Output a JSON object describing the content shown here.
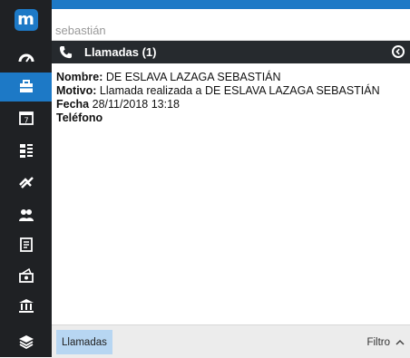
{
  "logo": {
    "letter": "m"
  },
  "search": {
    "value": "sebastián"
  },
  "header": {
    "title": "Llamadas (1)"
  },
  "record": {
    "nombre_label": "Nombre:",
    "nombre_value": " DE ESLAVA LAZAGA SEBASTIÁN",
    "motivo_label": "Motivo:",
    "motivo_value": " Llamada realizada a DE ESLAVA LAZAGA SEBASTIÁN",
    "fecha_label": "Fecha",
    "fecha_value": " 28/11/2018 13:18",
    "telefono_label": "Teléfono"
  },
  "bottom": {
    "tab_label": "Llamadas",
    "filter_label": "Filtro"
  },
  "sidebar": {
    "items": [
      {
        "icon": "dashboard-icon"
      },
      {
        "icon": "briefcase-icon",
        "active": true
      },
      {
        "icon": "calendar-icon",
        "text": "7"
      },
      {
        "icon": "list-icon"
      },
      {
        "icon": "handshake-icon"
      },
      {
        "icon": "contacts-icon"
      },
      {
        "icon": "document-icon"
      },
      {
        "icon": "money-icon"
      },
      {
        "icon": "bank-icon"
      },
      {
        "icon": "layers-icon"
      }
    ]
  },
  "colors": {
    "accent": "#1d79c6",
    "sidebar": "#1f2124",
    "header": "#262a2e",
    "tab": "#b7d6f2"
  }
}
